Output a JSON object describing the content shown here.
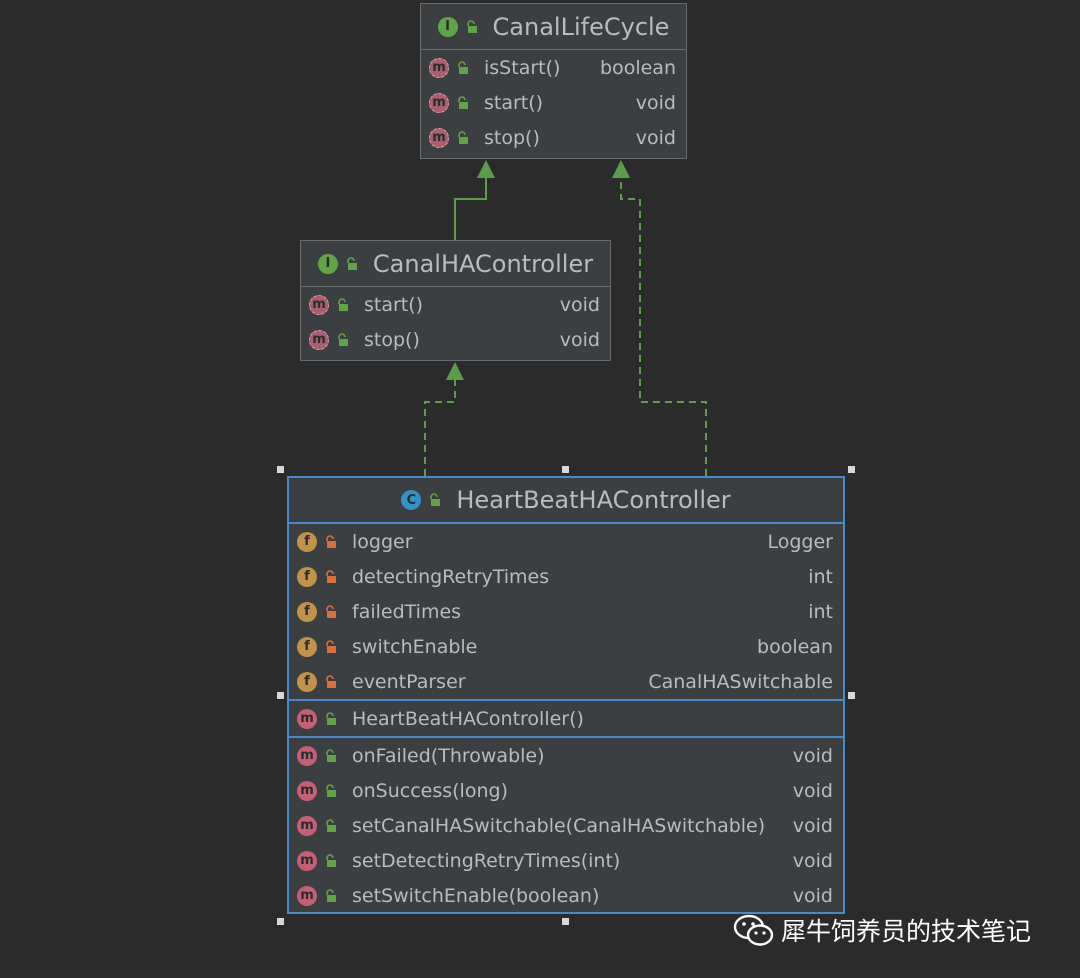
{
  "interfaces": {
    "lifecycle": {
      "icon": "interface-icon",
      "title": "CanalLifeCycle",
      "methods": [
        {
          "name": "isStart()",
          "type": "boolean"
        },
        {
          "name": "start()",
          "type": "void"
        },
        {
          "name": "stop()",
          "type": "void"
        }
      ]
    },
    "ha_controller": {
      "icon": "interface-icon",
      "title": "CanalHAController",
      "methods": [
        {
          "name": "start()",
          "type": "void"
        },
        {
          "name": "stop()",
          "type": "void"
        }
      ]
    }
  },
  "class_box": {
    "icon": "class-icon",
    "title": "HeartBeatHAController",
    "fields": [
      {
        "name": "logger",
        "type": "Logger"
      },
      {
        "name": "detectingRetryTimes",
        "type": "int"
      },
      {
        "name": "failedTimes",
        "type": "int"
      },
      {
        "name": "switchEnable",
        "type": "boolean"
      },
      {
        "name": "eventParser",
        "type": "CanalHASwitchable"
      }
    ],
    "constructor": {
      "name": "HeartBeatHAController()",
      "type": ""
    },
    "methods": [
      {
        "name": "onFailed(Throwable)",
        "type": "void"
      },
      {
        "name": "onSuccess(long)",
        "type": "void"
      },
      {
        "name": "setCanalHASwitchable(CanalHASwitchable)",
        "type": "void"
      },
      {
        "name": "setDetectingRetryTimes(int)",
        "type": "void"
      },
      {
        "name": "setSwitchEnable(boolean)",
        "type": "void"
      }
    ]
  },
  "relations": [
    {
      "from": "CanalHAController",
      "to": "CanalLifeCycle",
      "kind": "extends"
    },
    {
      "from": "HeartBeatHAController",
      "to": "CanalHAController",
      "kind": "implements"
    },
    {
      "from": "HeartBeatHAController",
      "to": "CanalLifeCycle",
      "kind": "implements"
    }
  ],
  "icon_letters": {
    "interface": "I",
    "class": "C",
    "field": "f",
    "method": "m"
  },
  "watermark": {
    "text": "犀牛饲养员的技术笔记",
    "icon": "wechat-icon"
  },
  "colors": {
    "background": "#2b2b2b",
    "box": "#3c3f41",
    "selected_border": "#4a88c7",
    "arrow": "#5d9b4e"
  }
}
